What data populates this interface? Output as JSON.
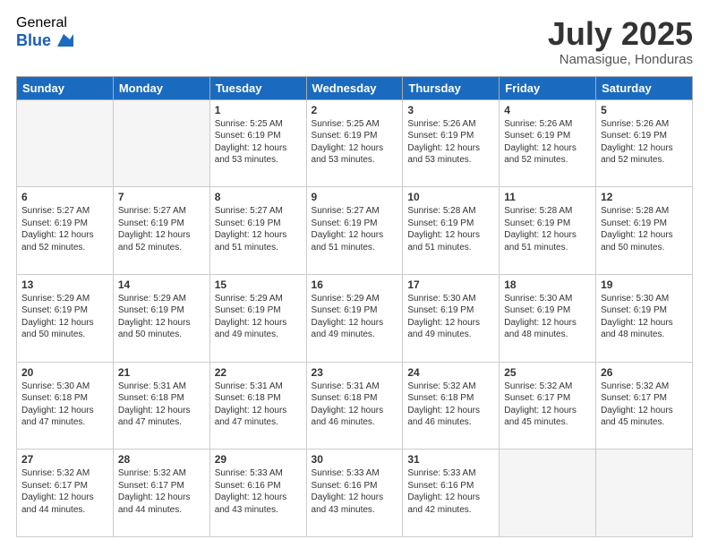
{
  "logo": {
    "general": "General",
    "blue": "Blue"
  },
  "header": {
    "month": "July 2025",
    "location": "Namasigue, Honduras"
  },
  "weekdays": [
    "Sunday",
    "Monday",
    "Tuesday",
    "Wednesday",
    "Thursday",
    "Friday",
    "Saturday"
  ],
  "weeks": [
    [
      {
        "day": "",
        "info": ""
      },
      {
        "day": "",
        "info": ""
      },
      {
        "day": "1",
        "info": "Sunrise: 5:25 AM\nSunset: 6:19 PM\nDaylight: 12 hours and 53 minutes."
      },
      {
        "day": "2",
        "info": "Sunrise: 5:25 AM\nSunset: 6:19 PM\nDaylight: 12 hours and 53 minutes."
      },
      {
        "day": "3",
        "info": "Sunrise: 5:26 AM\nSunset: 6:19 PM\nDaylight: 12 hours and 53 minutes."
      },
      {
        "day": "4",
        "info": "Sunrise: 5:26 AM\nSunset: 6:19 PM\nDaylight: 12 hours and 52 minutes."
      },
      {
        "day": "5",
        "info": "Sunrise: 5:26 AM\nSunset: 6:19 PM\nDaylight: 12 hours and 52 minutes."
      }
    ],
    [
      {
        "day": "6",
        "info": "Sunrise: 5:27 AM\nSunset: 6:19 PM\nDaylight: 12 hours and 52 minutes."
      },
      {
        "day": "7",
        "info": "Sunrise: 5:27 AM\nSunset: 6:19 PM\nDaylight: 12 hours and 52 minutes."
      },
      {
        "day": "8",
        "info": "Sunrise: 5:27 AM\nSunset: 6:19 PM\nDaylight: 12 hours and 51 minutes."
      },
      {
        "day": "9",
        "info": "Sunrise: 5:27 AM\nSunset: 6:19 PM\nDaylight: 12 hours and 51 minutes."
      },
      {
        "day": "10",
        "info": "Sunrise: 5:28 AM\nSunset: 6:19 PM\nDaylight: 12 hours and 51 minutes."
      },
      {
        "day": "11",
        "info": "Sunrise: 5:28 AM\nSunset: 6:19 PM\nDaylight: 12 hours and 51 minutes."
      },
      {
        "day": "12",
        "info": "Sunrise: 5:28 AM\nSunset: 6:19 PM\nDaylight: 12 hours and 50 minutes."
      }
    ],
    [
      {
        "day": "13",
        "info": "Sunrise: 5:29 AM\nSunset: 6:19 PM\nDaylight: 12 hours and 50 minutes."
      },
      {
        "day": "14",
        "info": "Sunrise: 5:29 AM\nSunset: 6:19 PM\nDaylight: 12 hours and 50 minutes."
      },
      {
        "day": "15",
        "info": "Sunrise: 5:29 AM\nSunset: 6:19 PM\nDaylight: 12 hours and 49 minutes."
      },
      {
        "day": "16",
        "info": "Sunrise: 5:29 AM\nSunset: 6:19 PM\nDaylight: 12 hours and 49 minutes."
      },
      {
        "day": "17",
        "info": "Sunrise: 5:30 AM\nSunset: 6:19 PM\nDaylight: 12 hours and 49 minutes."
      },
      {
        "day": "18",
        "info": "Sunrise: 5:30 AM\nSunset: 6:19 PM\nDaylight: 12 hours and 48 minutes."
      },
      {
        "day": "19",
        "info": "Sunrise: 5:30 AM\nSunset: 6:19 PM\nDaylight: 12 hours and 48 minutes."
      }
    ],
    [
      {
        "day": "20",
        "info": "Sunrise: 5:30 AM\nSunset: 6:18 PM\nDaylight: 12 hours and 47 minutes."
      },
      {
        "day": "21",
        "info": "Sunrise: 5:31 AM\nSunset: 6:18 PM\nDaylight: 12 hours and 47 minutes."
      },
      {
        "day": "22",
        "info": "Sunrise: 5:31 AM\nSunset: 6:18 PM\nDaylight: 12 hours and 47 minutes."
      },
      {
        "day": "23",
        "info": "Sunrise: 5:31 AM\nSunset: 6:18 PM\nDaylight: 12 hours and 46 minutes."
      },
      {
        "day": "24",
        "info": "Sunrise: 5:32 AM\nSunset: 6:18 PM\nDaylight: 12 hours and 46 minutes."
      },
      {
        "day": "25",
        "info": "Sunrise: 5:32 AM\nSunset: 6:17 PM\nDaylight: 12 hours and 45 minutes."
      },
      {
        "day": "26",
        "info": "Sunrise: 5:32 AM\nSunset: 6:17 PM\nDaylight: 12 hours and 45 minutes."
      }
    ],
    [
      {
        "day": "27",
        "info": "Sunrise: 5:32 AM\nSunset: 6:17 PM\nDaylight: 12 hours and 44 minutes."
      },
      {
        "day": "28",
        "info": "Sunrise: 5:32 AM\nSunset: 6:17 PM\nDaylight: 12 hours and 44 minutes."
      },
      {
        "day": "29",
        "info": "Sunrise: 5:33 AM\nSunset: 6:16 PM\nDaylight: 12 hours and 43 minutes."
      },
      {
        "day": "30",
        "info": "Sunrise: 5:33 AM\nSunset: 6:16 PM\nDaylight: 12 hours and 43 minutes."
      },
      {
        "day": "31",
        "info": "Sunrise: 5:33 AM\nSunset: 6:16 PM\nDaylight: 12 hours and 42 minutes."
      },
      {
        "day": "",
        "info": ""
      },
      {
        "day": "",
        "info": ""
      }
    ]
  ]
}
